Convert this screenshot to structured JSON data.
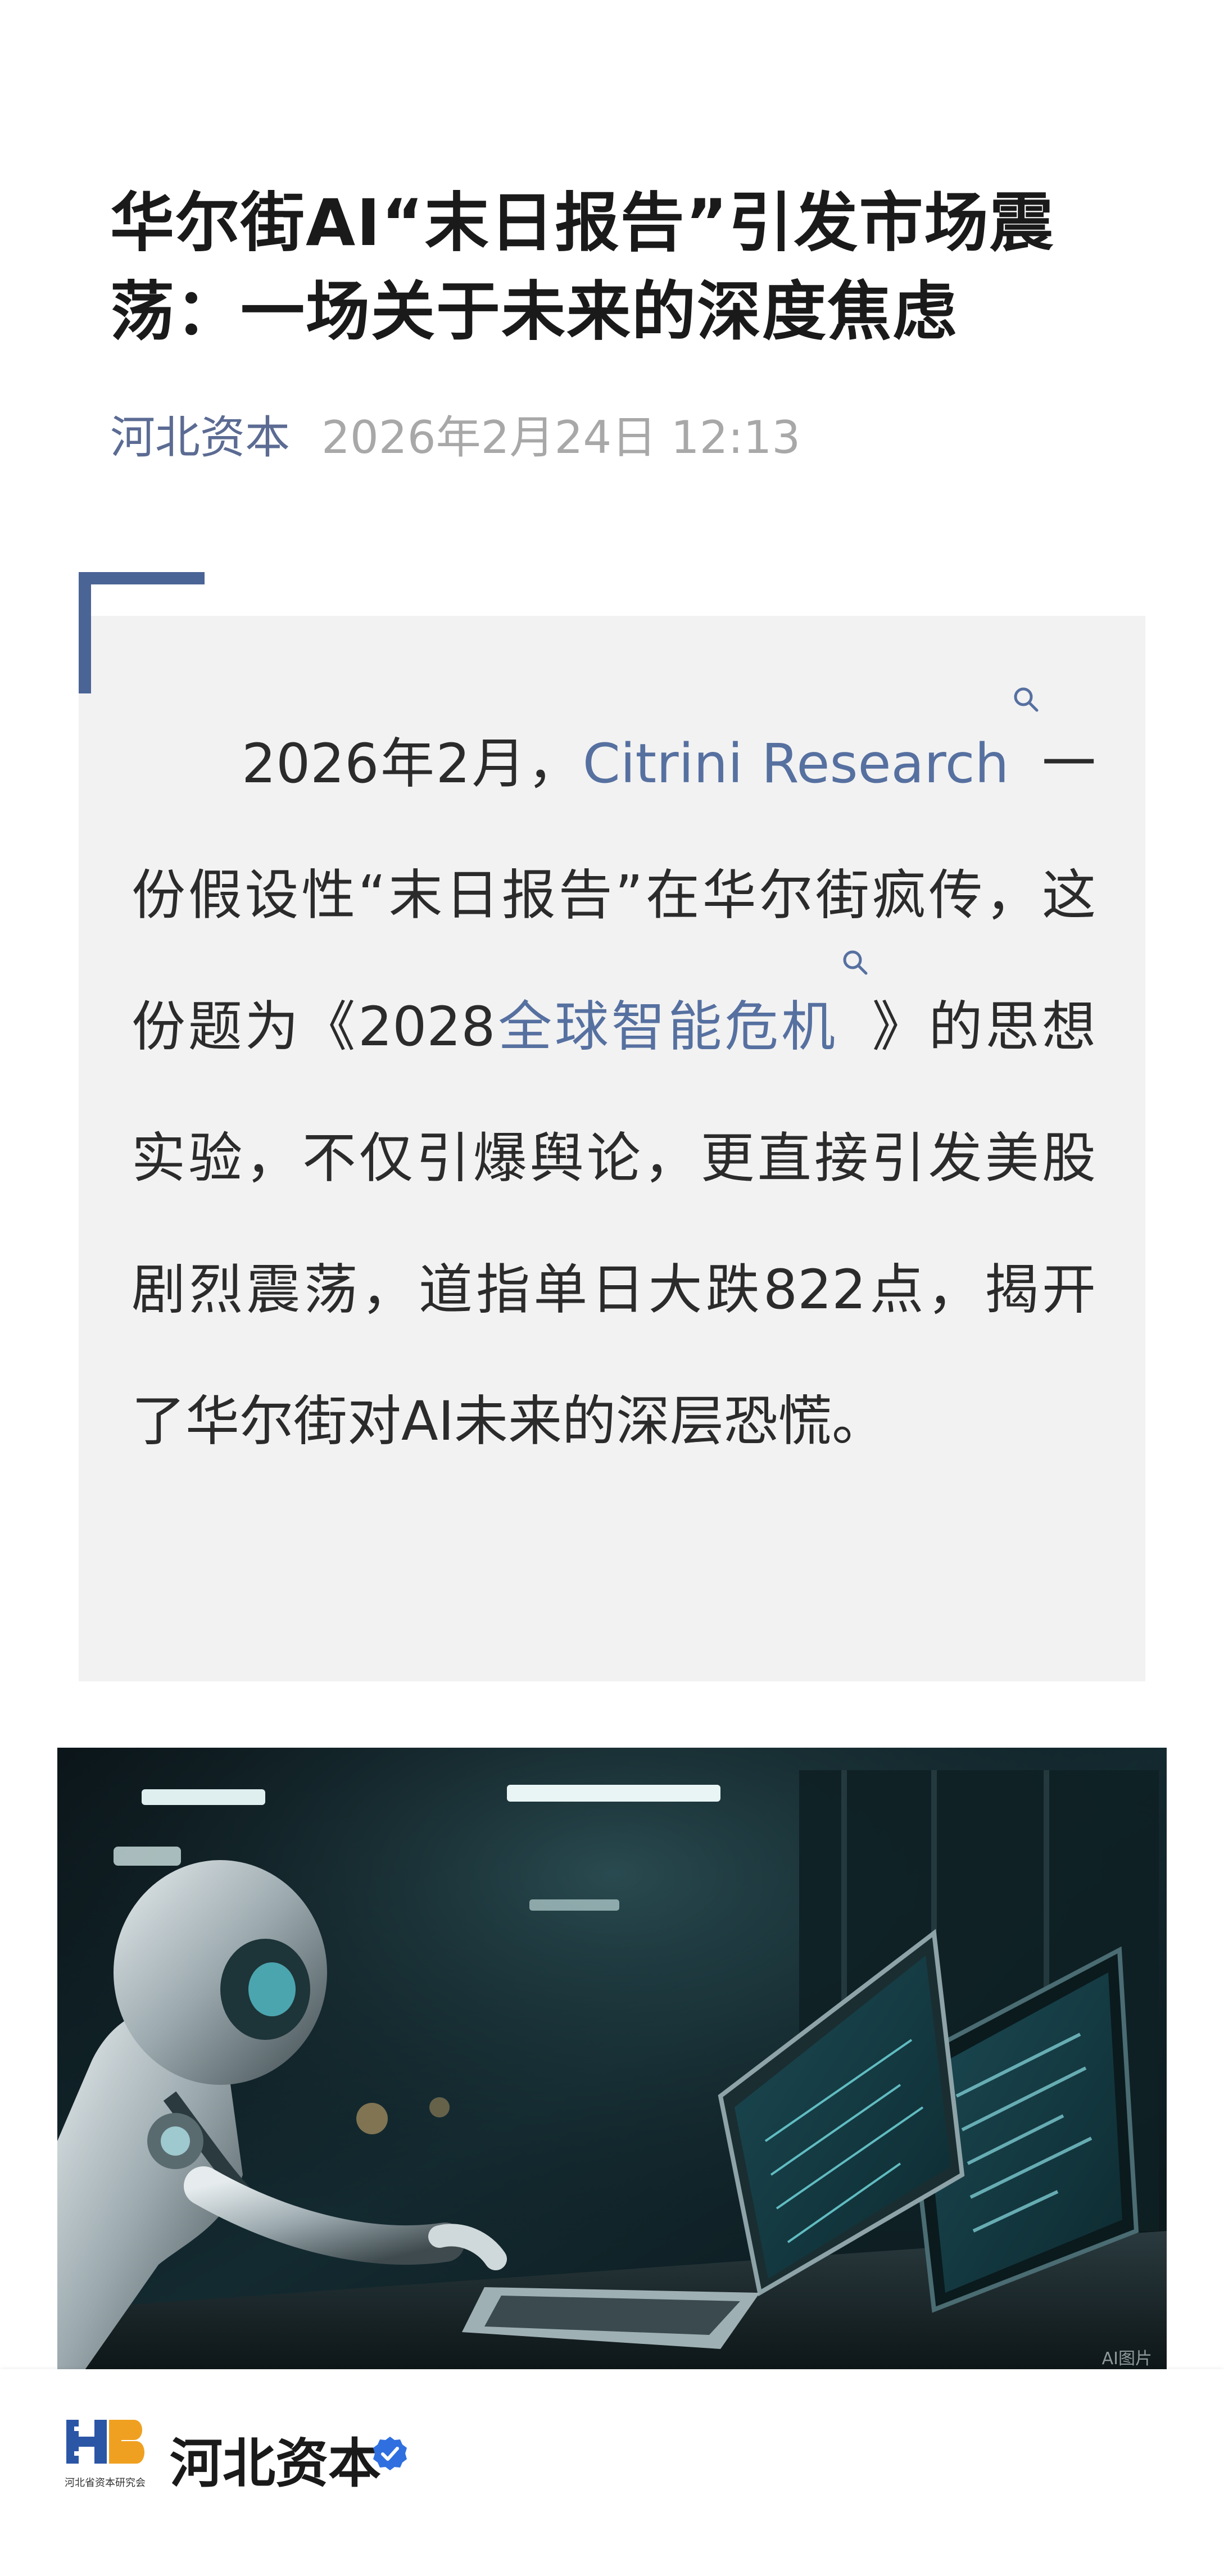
{
  "article": {
    "title": "华尔街AI“末日报告”引发市场震荡：一场关于未来的深度焦虑",
    "source": "河北资本",
    "date": "2026年2月24日 12:13"
  },
  "quote": {
    "part1": "2026年2月，",
    "link1": "Citrini Research",
    "part2": "一份假设性“末日报告”在华尔街疯传，这份题为《2028",
    "link2": "全球智能危机",
    "part3": "》的思想实验，不仅引爆舆论，更直接引发美股剧烈震荡，道指单日大跌822点，揭开了华尔街对AI未来的深层恐慌。",
    "link_color": "#5670a0",
    "accent_color": "#4a6496"
  },
  "image": {
    "description_icon": "robot-at-laptop-illustration",
    "tag": "AI图片"
  },
  "footer": {
    "account_name": "河北资本",
    "logo_caption": "河北省资本研究会",
    "logo_letters": "HB",
    "verified_icon": "verified-badge-icon"
  }
}
